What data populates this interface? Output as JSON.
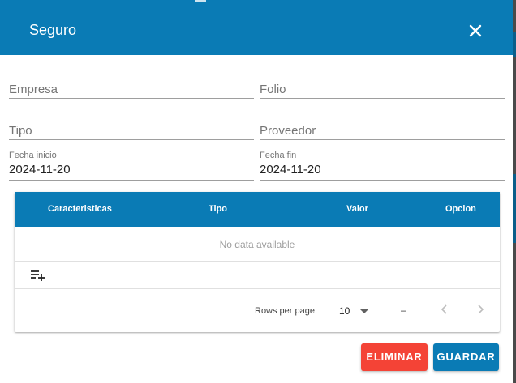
{
  "dialog": {
    "title": "Seguro",
    "close_icon": "close-icon"
  },
  "form": {
    "empresa": {
      "label": "Empresa",
      "value": ""
    },
    "folio": {
      "label": "Folio",
      "value": ""
    },
    "tipo": {
      "label": "Tipo",
      "value": ""
    },
    "proveedor": {
      "label": "Proveedor",
      "value": ""
    },
    "fecha_inicio": {
      "label": "Fecha inicio",
      "value": "2024-11-20"
    },
    "fecha_fin": {
      "label": "Fecha fin",
      "value": "2024-11-20"
    }
  },
  "table": {
    "headers": [
      "Caracteristicas",
      "Tipo",
      "Valor",
      "Opcion"
    ],
    "empty_text": "No data available",
    "add_icon": "playlist-add-icon",
    "footer": {
      "rows_per_page_label": "Rows per page:",
      "rows_per_page_value": "10",
      "range_text": "–",
      "prev_icon": "chevron-left-icon",
      "next_icon": "chevron-right-icon"
    }
  },
  "actions": {
    "delete_label": "ELIMINAR",
    "save_label": "GUARDAR"
  },
  "colors": {
    "primary": "#0a7bb5",
    "danger": "#f44336"
  }
}
